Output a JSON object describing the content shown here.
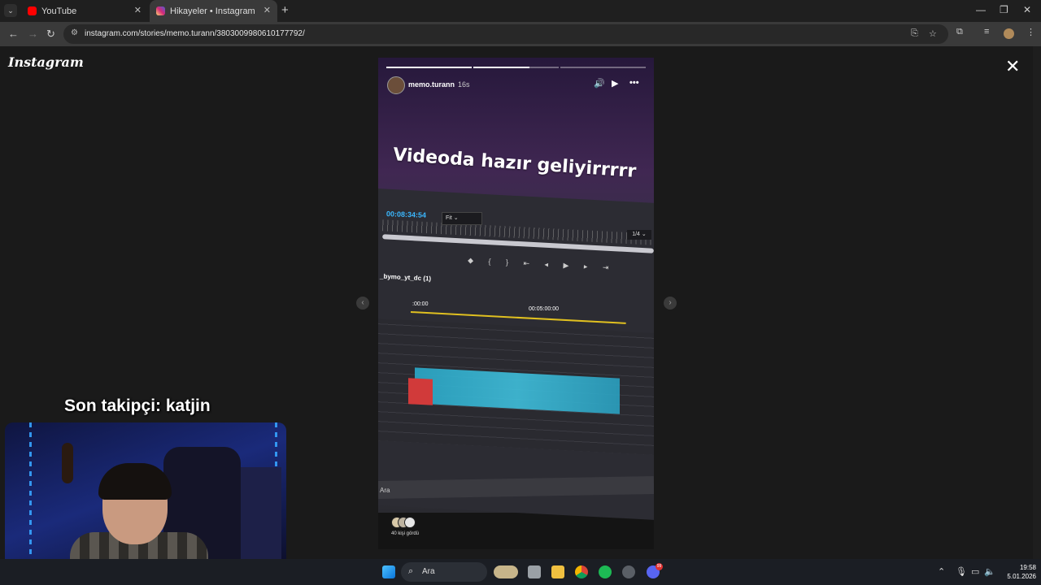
{
  "browser": {
    "tabs": [
      {
        "title": "YouTube",
        "favicon": "youtube-icon",
        "color": "#ff0000"
      },
      {
        "title": "Hikayeler • Instagram",
        "favicon": "instagram-icon",
        "color": "#d62976"
      }
    ],
    "url": "instagram.com/stories/memo.turann/3803009980610177792/"
  },
  "instagram": {
    "logo": "Instagram",
    "story": {
      "username": "memo.turann",
      "time_ago": "16s",
      "caption": "Videoda hazır geliyirrrrr",
      "viewers_text": "40 kişi gördü",
      "segments": 3,
      "current_segment": 2,
      "screen": {
        "timecode": "00:08:34:54",
        "fit_label": "Fit",
        "zoom_label": "1/4",
        "sequence_name": "_bymo_yt_dc (1)",
        "timeline_start": ":00:00",
        "timeline_mark": "00:05:00:00",
        "taskbar_search": "Ara"
      }
    }
  },
  "stream_overlay": {
    "follower_text": "Son takipçi: katjin"
  },
  "windows_taskbar": {
    "search_placeholder": "Ara",
    "time": "19:58",
    "date": "5.01.2026",
    "badge_count": "99"
  }
}
